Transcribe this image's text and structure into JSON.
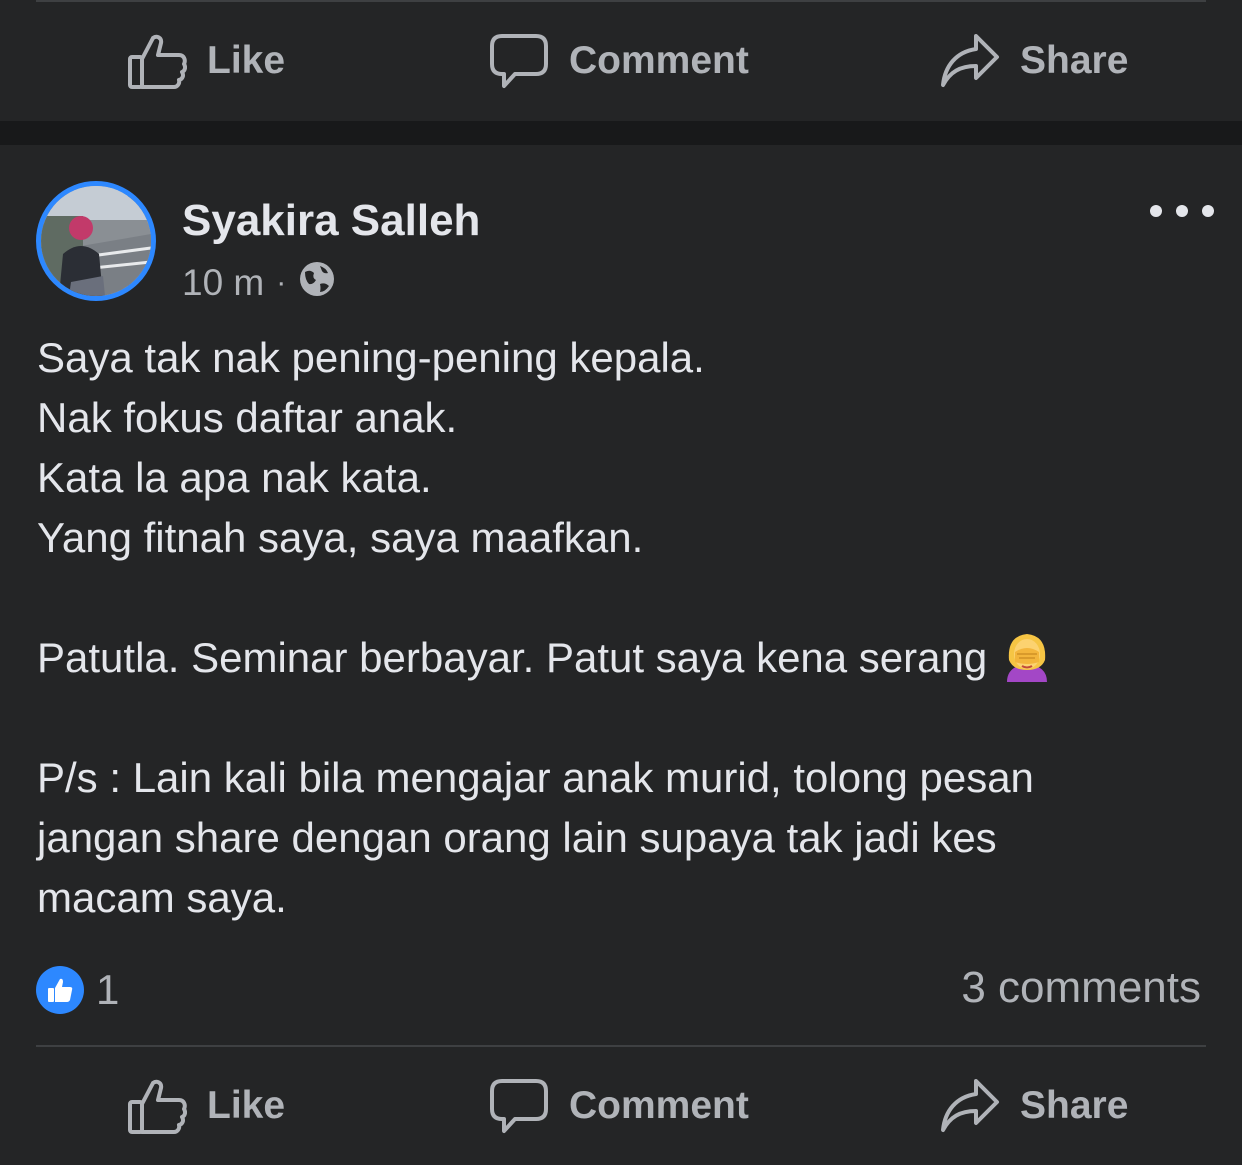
{
  "top_actions": {
    "like_label": "Like",
    "comment_label": "Comment",
    "share_label": "Share"
  },
  "post": {
    "author": "Syakira Salleh",
    "time": "10 m",
    "separator": "·",
    "audience_icon": "globe-icon",
    "menu_icon": "more-options-icon",
    "lines": [
      "Saya tak nak pening-pening kepala.",
      "Nak fokus daftar anak.",
      "Kata la apa nak kata.",
      "Yang fitnah saya, saya maafkan.",
      "",
      "Patutla. Seminar berbayar. Patut saya kena serang",
      "",
      "P/s : Lain kali bila mengajar anak murid, tolong pesan",
      "jangan share dengan orang lain supaya tak jadi kes",
      "macam saya."
    ],
    "emoji": "woman-facepalming-icon",
    "reaction_icon": "like-reaction-icon",
    "reaction_count": "1",
    "comment_count": "3 comments"
  },
  "bottom_actions": {
    "like_label": "Like",
    "comment_label": "Comment",
    "share_label": "Share"
  },
  "colors": {
    "background": "#242526",
    "separator_band": "#18191a",
    "text_primary": "#e4e6eb",
    "text_secondary": "#b0b3b8",
    "accent": "#2d88ff"
  }
}
